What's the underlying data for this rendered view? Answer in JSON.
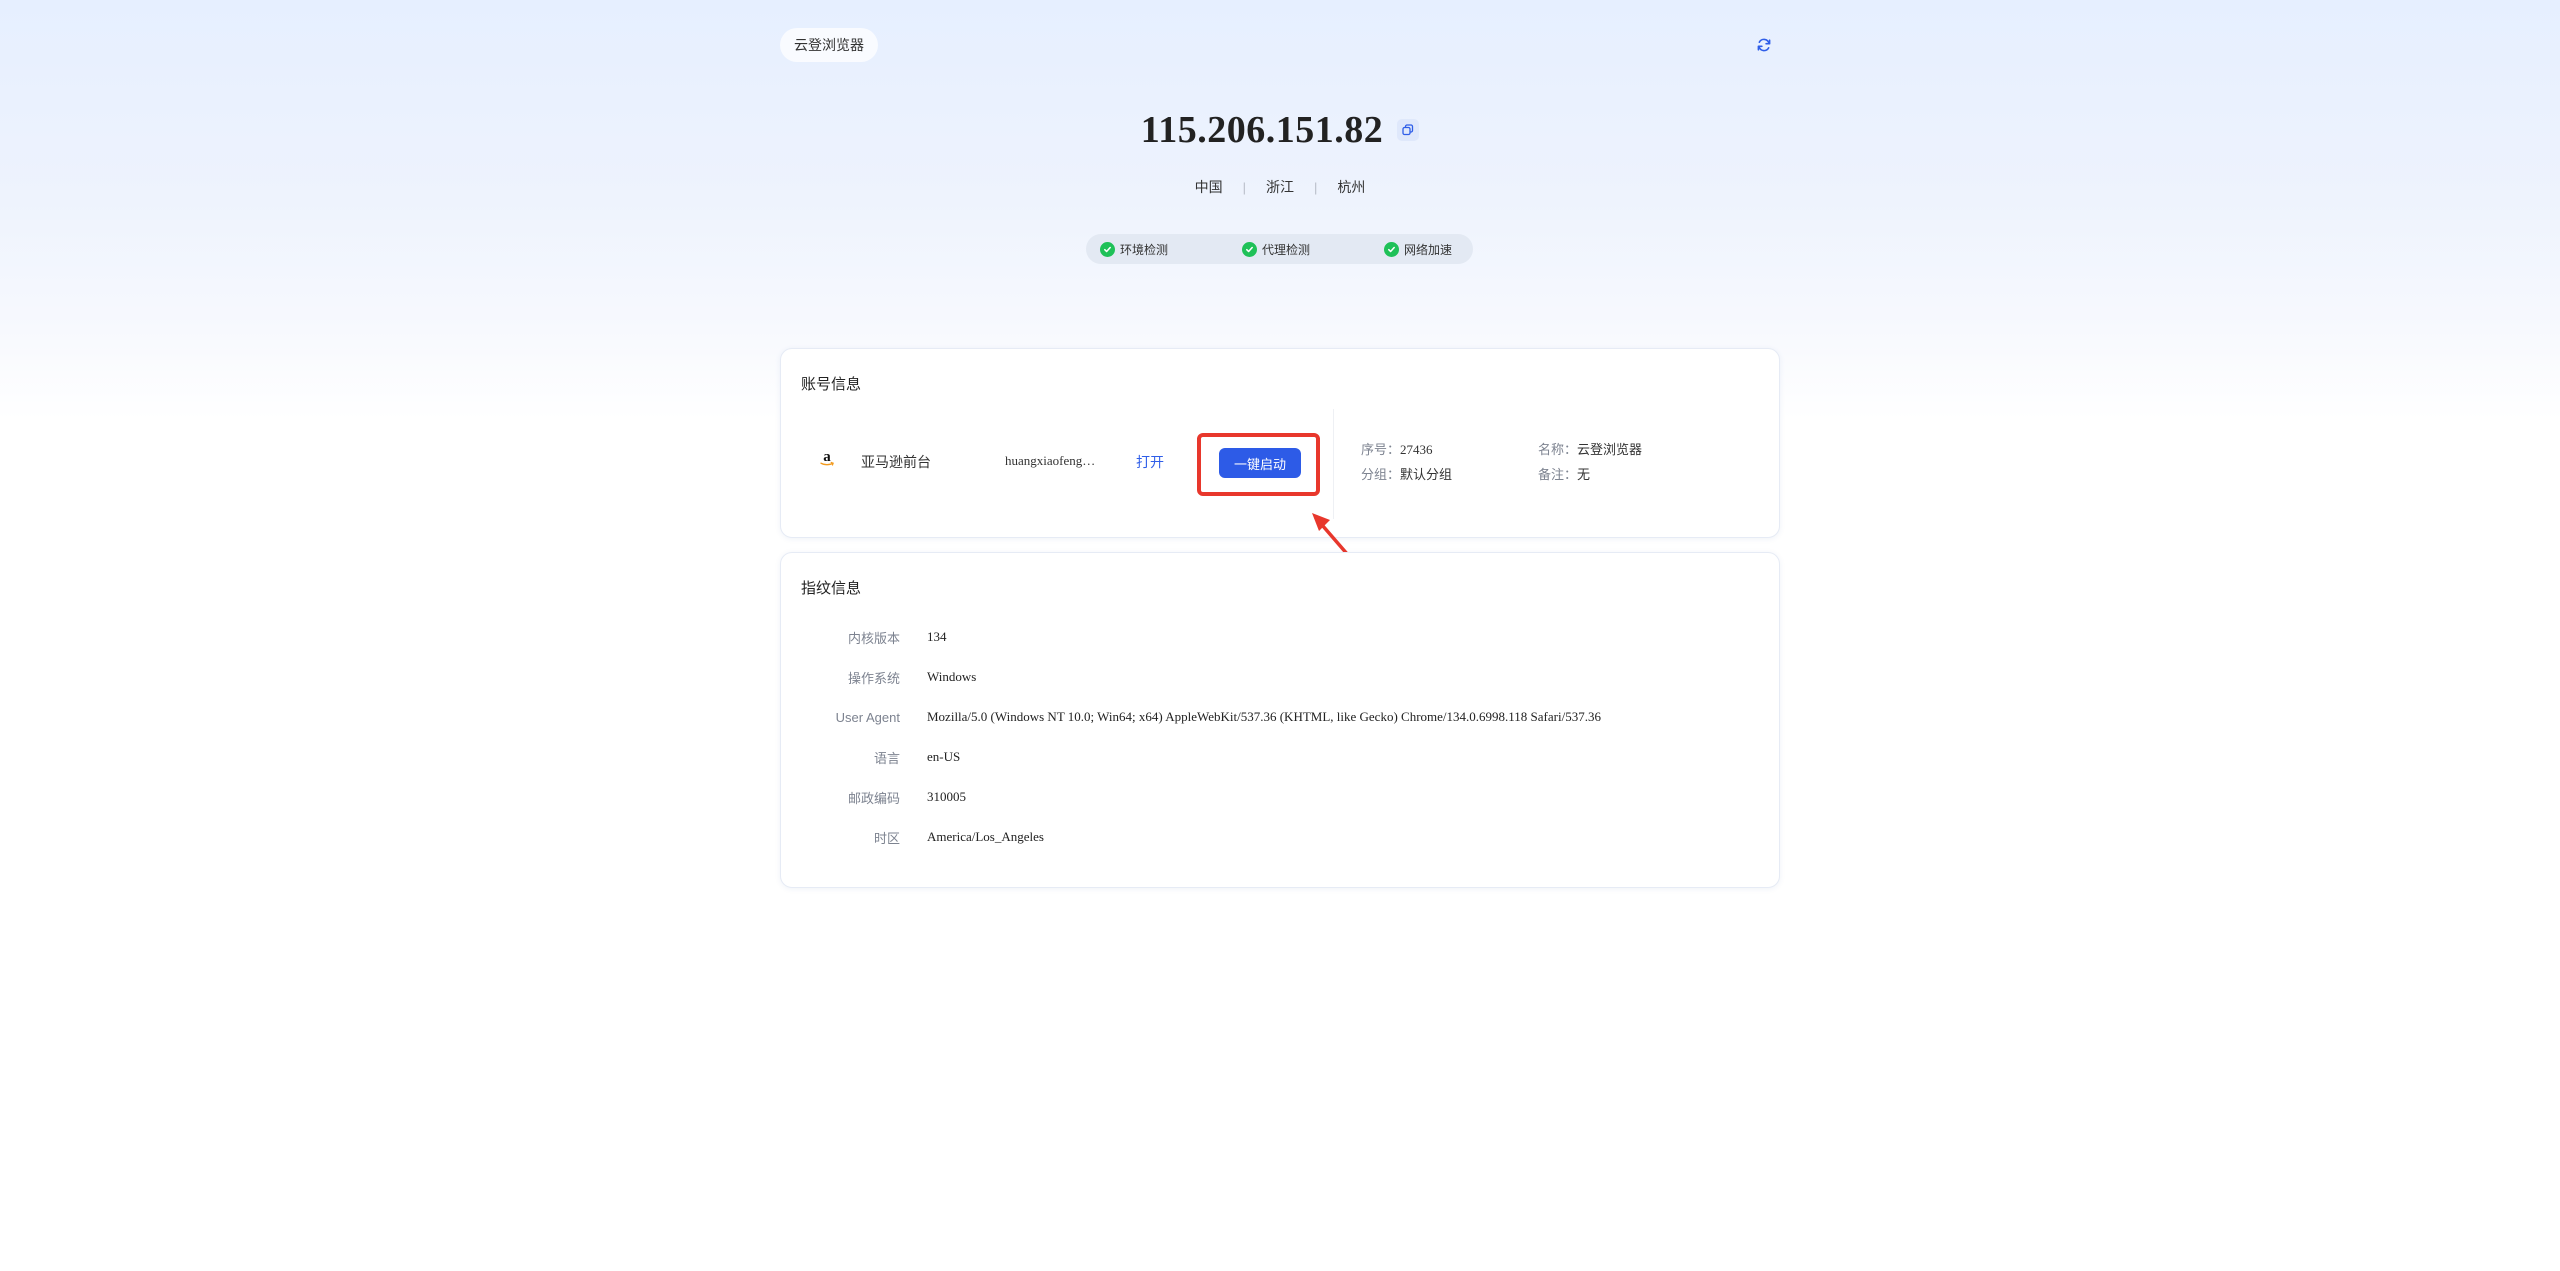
{
  "header": {
    "brand": "云登浏览器",
    "refresh_icon": "refresh-icon"
  },
  "ip_info": {
    "ip": "115.206.151.82",
    "copy_icon": "copy-icon",
    "country": "中国",
    "province": "浙江",
    "city": "杭州"
  },
  "checks": [
    {
      "label": "环境检测",
      "status": "passed",
      "icon": "check-circle-icon"
    },
    {
      "label": "代理检测",
      "status": "passed",
      "icon": "check-circle-icon"
    },
    {
      "label": "网络加速",
      "status": "passed",
      "icon": "check-circle-icon"
    }
  ],
  "account": {
    "title": "账号信息",
    "platform": "亚马逊前台",
    "platform_icon": "amazon-logo-icon",
    "username": "huangxiaofeng…",
    "open_label": "打开",
    "launch_label": "一键启动",
    "serial_label": "序号：",
    "serial": "27436",
    "group_label": "分组：",
    "group": "默认分组",
    "name_label": "名称：",
    "name": "云登浏览器",
    "remark_label": "备注：",
    "remark": "无"
  },
  "fingerprint": {
    "title": "指纹信息",
    "rows": [
      {
        "label": "内核版本",
        "value": "134"
      },
      {
        "label": "操作系统",
        "value": "Windows"
      },
      {
        "label": "User Agent",
        "value": "Mozilla/5.0 (Windows NT 10.0; Win64; x64) AppleWebKit/537.36 (KHTML, like Gecko) Chrome/134.0.6998.118 Safari/537.36"
      },
      {
        "label": "语言",
        "value": "en-US"
      },
      {
        "label": "邮政编码",
        "value": "310005"
      },
      {
        "label": "时区",
        "value": "America/Los_Angeles"
      }
    ]
  },
  "colors": {
    "accent": "#2d5be7",
    "success": "#1fc158",
    "annotation": "#e8372c"
  }
}
